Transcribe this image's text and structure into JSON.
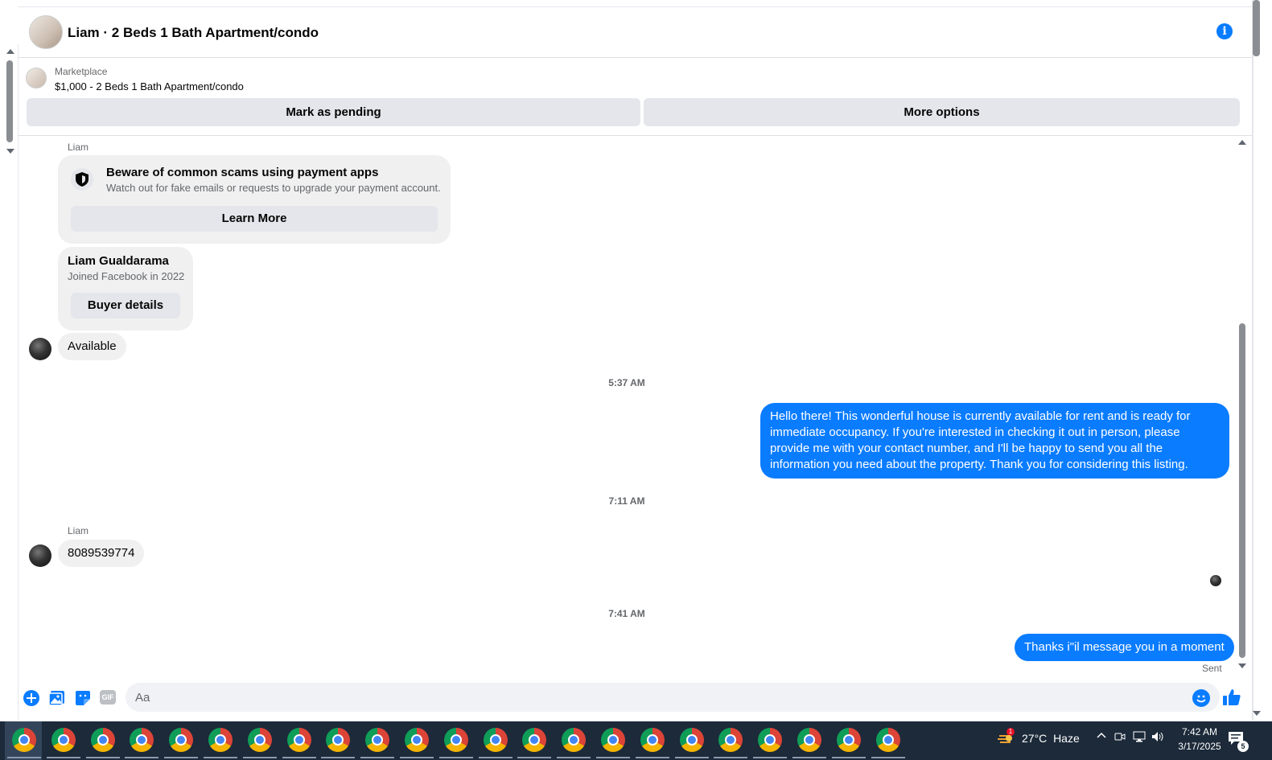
{
  "header": {
    "title": "Liam · 2 Beds 1 Bath Apartment/condo",
    "info_icon": "i"
  },
  "listing": {
    "source": "Marketplace",
    "price_title": "$1,000 - 2 Beds 1 Bath Apartment/condo",
    "pending_label": "Mark as pending",
    "more_label": "More options"
  },
  "messages": {
    "sender_top": "Liam",
    "scam_title": "Beware of common scams using payment apps",
    "scam_text": "Watch out for fake emails or requests to upgrade your payment account.",
    "learn_more": "Learn More",
    "buyer_name": "Liam Gualdarama",
    "buyer_joined": "Joined Facebook in 2022",
    "buyer_details": "Buyer details",
    "available": "Available",
    "time1": "5:37 AM",
    "outgoing1": "Hello there! This wonderful house is currently available for rent and is ready for immediate occupancy. If you're interested in checking it out in person, please provide me with your contact number, and I'll be happy to send you all the information you need about the property. Thank you for considering this listing.",
    "time2": "7:11 AM",
    "sender_mid": "Liam",
    "phone": "8089539774",
    "time3": "7:41 AM",
    "outgoing2": "Thanks i\"il message you in a moment",
    "status": "Sent"
  },
  "composer": {
    "placeholder": "Aa",
    "gif_label": "GIF"
  },
  "taskbar": {
    "app_count": 23,
    "weather_badge": "1",
    "temperature": "27°C",
    "weather": "Haze",
    "time": "7:42 AM",
    "date": "3/17/2025",
    "notifications": "5"
  },
  "colors": {
    "messenger_blue": "#0a7cff",
    "bubble_gray": "#f0f0f0",
    "button_gray": "#e4e6eb",
    "taskbar": "#1c2a3a"
  }
}
